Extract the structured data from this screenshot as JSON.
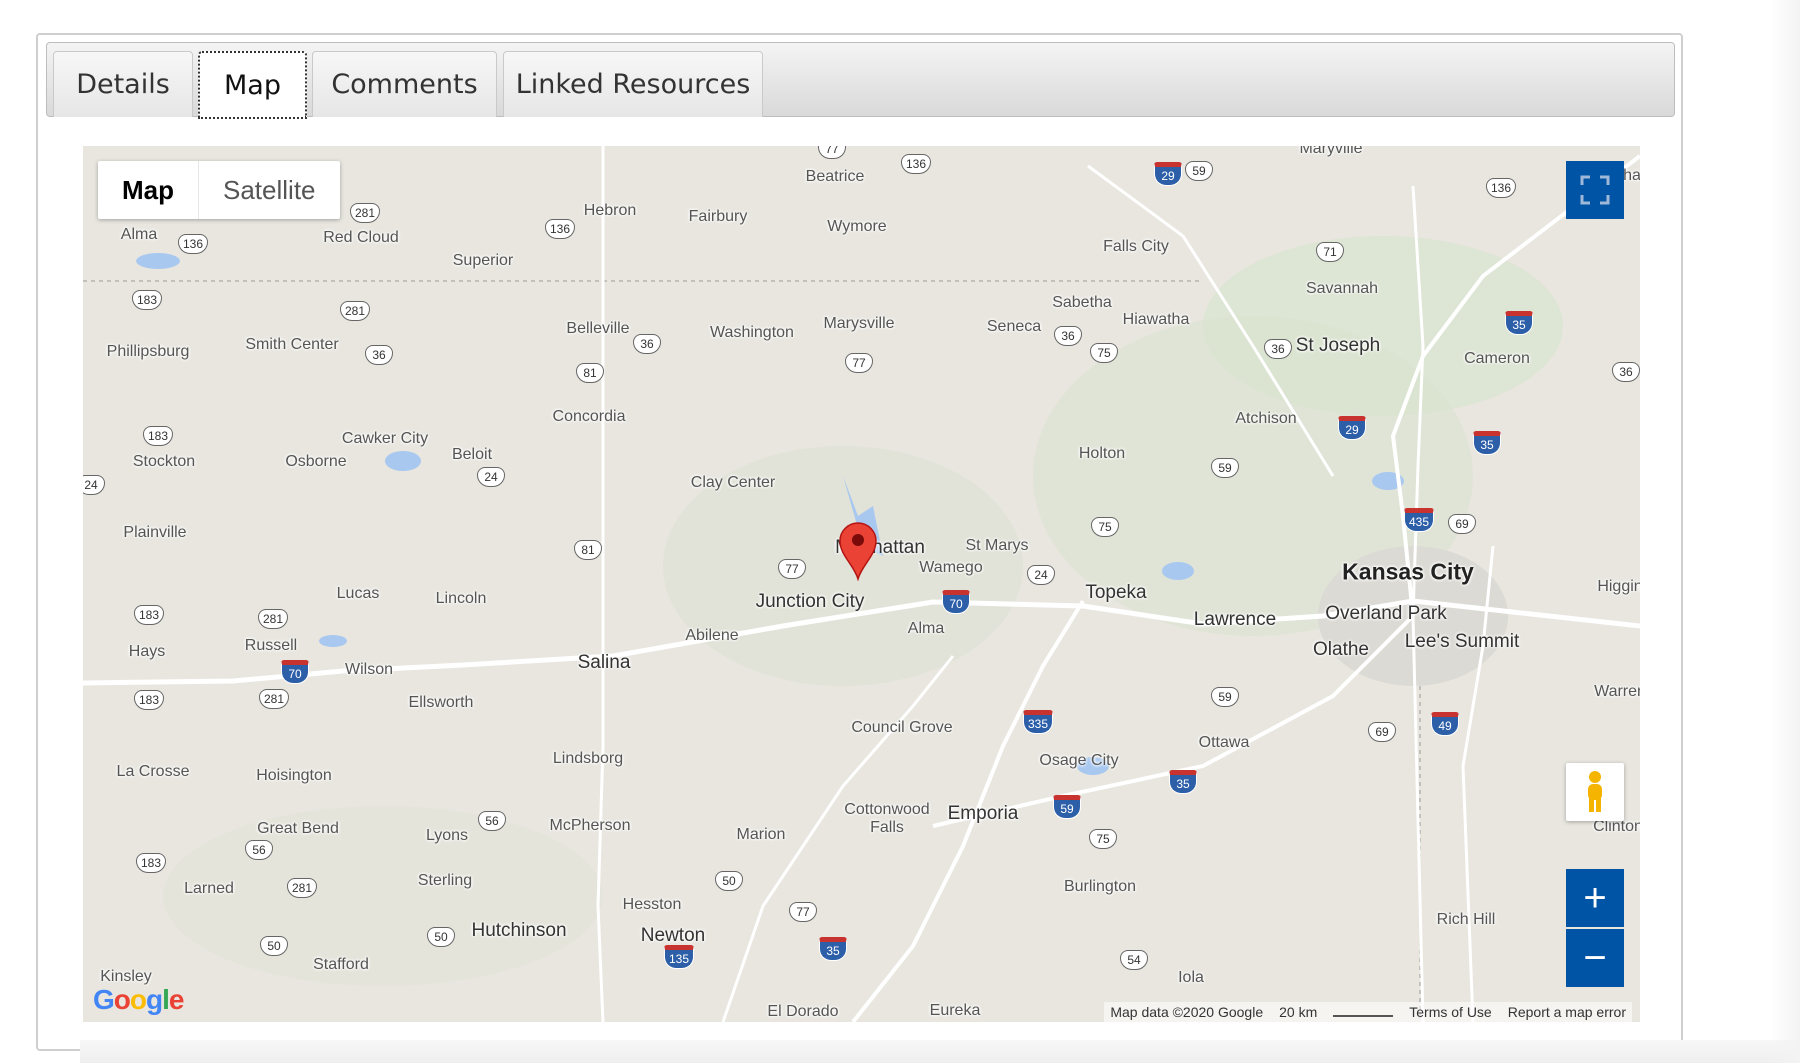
{
  "tabs": [
    {
      "label": "Details"
    },
    {
      "label": "Map"
    },
    {
      "label": "Comments"
    },
    {
      "label": "Linked Resources"
    }
  ],
  "active_tab": "Map",
  "map": {
    "type_buttons": {
      "map": "Map",
      "satellite": "Satellite"
    },
    "selected_type": "Map",
    "attribution": "Map data ©2020 Google",
    "scale": "20 km",
    "terms": "Terms of Use",
    "report": "Report a map error",
    "logo": "Google",
    "zoom_in": "+",
    "zoom_out": "−",
    "marker": "Manhattan",
    "cities": [
      {
        "name": "Beatrice"
      },
      {
        "name": "Maryville"
      },
      {
        "name": "Hebron"
      },
      {
        "name": "Fairbury"
      },
      {
        "name": "Wymore"
      },
      {
        "name": "Alma"
      },
      {
        "name": "Red Cloud"
      },
      {
        "name": "Superior"
      },
      {
        "name": "Falls City"
      },
      {
        "name": "Savannah"
      },
      {
        "name": "Sabetha"
      },
      {
        "name": "Hiawatha"
      },
      {
        "name": "St Joseph"
      },
      {
        "name": "Cameron"
      },
      {
        "name": "Belleville"
      },
      {
        "name": "Washington"
      },
      {
        "name": "Marysville"
      },
      {
        "name": "Seneca"
      },
      {
        "name": "Phillipsburg"
      },
      {
        "name": "Smith Center"
      },
      {
        "name": "Concordia"
      },
      {
        "name": "Atchison"
      },
      {
        "name": "Cawker City"
      },
      {
        "name": "Beloit"
      },
      {
        "name": "Stockton"
      },
      {
        "name": "Osborne"
      },
      {
        "name": "Holton"
      },
      {
        "name": "Clay Center"
      },
      {
        "name": "Plainville"
      },
      {
        "name": "Manhattan"
      },
      {
        "name": "St Marys"
      },
      {
        "name": "Wamego"
      },
      {
        "name": "Kansas City"
      },
      {
        "name": "Junction City"
      },
      {
        "name": "Topeka"
      },
      {
        "name": "Lawrence"
      },
      {
        "name": "Overland Park"
      },
      {
        "name": "Lucas"
      },
      {
        "name": "Lincoln"
      },
      {
        "name": "Alma"
      },
      {
        "name": "Lee's Summit"
      },
      {
        "name": "Olathe"
      },
      {
        "name": "Hays"
      },
      {
        "name": "Russell"
      },
      {
        "name": "Wilson"
      },
      {
        "name": "Salina"
      },
      {
        "name": "Abilene"
      },
      {
        "name": "Ellsworth"
      },
      {
        "name": "Warren"
      },
      {
        "name": "Council Grove"
      },
      {
        "name": "Ottawa"
      },
      {
        "name": "Osage City"
      },
      {
        "name": "La Crosse"
      },
      {
        "name": "Hoisington"
      },
      {
        "name": "Lindsborg"
      },
      {
        "name": "Great Bend"
      },
      {
        "name": "Lyons"
      },
      {
        "name": "McPherson"
      },
      {
        "name": "Marion"
      },
      {
        "name": "Cottonwood Falls"
      },
      {
        "name": "Emporia"
      },
      {
        "name": "Clinton"
      },
      {
        "name": "Larned"
      },
      {
        "name": "Sterling"
      },
      {
        "name": "Burlington"
      },
      {
        "name": "Hesston"
      },
      {
        "name": "Rich Hill"
      },
      {
        "name": "Hutchinson"
      },
      {
        "name": "Newton"
      },
      {
        "name": "Kinsley"
      },
      {
        "name": "Stafford"
      },
      {
        "name": "Iola"
      },
      {
        "name": "El Dorado"
      },
      {
        "name": "Eureka"
      },
      {
        "name": "Betha"
      },
      {
        "name": "Higgin"
      }
    ],
    "routes": [
      "77",
      "136",
      "29",
      "59",
      "136",
      "281",
      "136",
      "71",
      "136",
      "183",
      "281",
      "36",
      "36",
      "81",
      "36",
      "77",
      "36",
      "75",
      "35",
      "36",
      "183",
      "29",
      "35",
      "24",
      "59",
      "75",
      "81",
      "24",
      "77",
      "435",
      "69",
      "70",
      "24",
      "183",
      "281",
      "70",
      "281",
      "183",
      "59",
      "335",
      "69",
      "49",
      "56",
      "183",
      "281",
      "50",
      "35",
      "75",
      "56",
      "50",
      "77",
      "35",
      "135",
      "50",
      "54",
      "59"
    ]
  }
}
